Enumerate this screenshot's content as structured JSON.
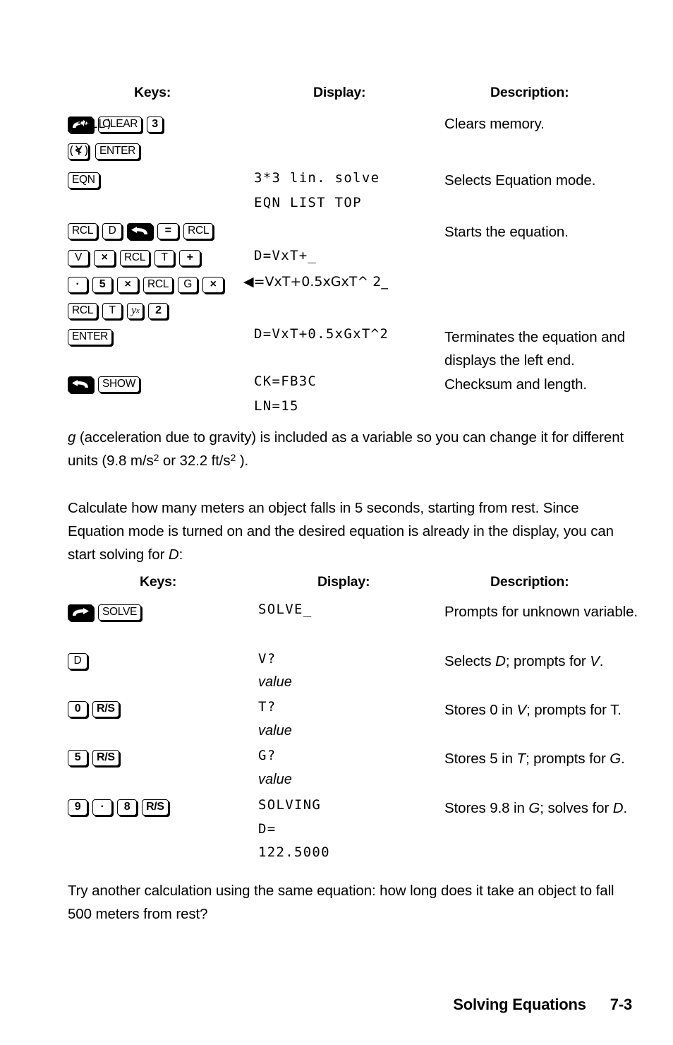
{
  "table1": {
    "headers": {
      "keys": "Keys:",
      "display": "Display:",
      "description": "Description:"
    },
    "rows": [
      {
        "keys_lines": [
          [
            {
              "type": "key",
              "style": "shift",
              "icon": "right-shift-arrow-icon"
            },
            {
              "type": "key",
              "label": "CLEAR"
            },
            {
              "type": "key",
              "label": "3",
              "bold": true
            },
            {
              "type": "text",
              "label": "(3ALL)",
              "lcd": true
            }
          ],
          [
            {
              "type": "key",
              "label": "<",
              "bold": true
            },
            {
              "type": "text",
              "label": "(Y)",
              "lcd": true
            },
            {
              "type": "key",
              "label": "ENTER"
            }
          ]
        ],
        "display_lines": [],
        "description": "Clears memory."
      },
      {
        "keys_lines": [
          [
            {
              "type": "key",
              "label": "EQN"
            }
          ]
        ],
        "display_lines": [
          "3*3 lin. solve",
          "EQN LIST TOP"
        ],
        "description": "Selects Equation mode."
      },
      {
        "keys_lines": [
          [
            {
              "type": "key",
              "label": "RCL"
            },
            {
              "type": "key",
              "label": "D"
            },
            {
              "type": "key",
              "style": "backarrow",
              "icon": "backspace-arrow-icon"
            },
            {
              "type": "key",
              "label": "="
            },
            {
              "type": "key",
              "label": "RCL"
            }
          ],
          [
            {
              "type": "key",
              "label": "V"
            },
            {
              "type": "key",
              "label": "×",
              "bold": true
            },
            {
              "type": "key",
              "label": "RCL"
            },
            {
              "type": "key",
              "label": "T"
            },
            {
              "type": "key",
              "label": "+",
              "bold": true
            }
          ],
          [
            {
              "type": "key",
              "label": "·",
              "bold": true
            },
            {
              "type": "key",
              "label": "5",
              "bold": true
            },
            {
              "type": "key",
              "label": "×",
              "bold": true
            },
            {
              "type": "key",
              "label": "RCL"
            },
            {
              "type": "key",
              "label": "G"
            },
            {
              "type": "key",
              "label": "×",
              "bold": true
            }
          ],
          [
            {
              "type": "key",
              "label": "RCL"
            },
            {
              "type": "key",
              "label": "T"
            },
            {
              "type": "key",
              "label": "yx",
              "serif": true
            },
            {
              "type": "key",
              "label": "2",
              "bold": true
            }
          ]
        ],
        "display_lines": [
          "D=VxT+_",
          "◀=VxT+0.5xGxT^ 2_"
        ],
        "description": "Starts the equation."
      },
      {
        "keys_lines": [
          [
            {
              "type": "key",
              "label": "ENTER"
            }
          ]
        ],
        "display_lines": [
          "D=VxT+0.5xGxT^2"
        ],
        "description": "Terminates the equation and displays the left end."
      },
      {
        "keys_lines": [
          [
            {
              "type": "key",
              "style": "backarrow",
              "icon": "backspace-arrow-icon"
            },
            {
              "type": "key",
              "label": "SHOW"
            }
          ]
        ],
        "display_lines": [
          "CK=FB3C",
          "LN=15"
        ],
        "description": "Checksum and length."
      }
    ]
  },
  "paragraphs": {
    "gravity_note_1": "g",
    "gravity_note_2": " (acceleration due to gravity) is included as a variable so you can change it for different units (9.8 m/s",
    "gravity_sup_1": "2",
    "gravity_note_3": " or 32.2 ft/s",
    "gravity_sup_2": "2",
    "gravity_note_4": " ).",
    "calc_intro_1": "Calculate how many meters an object falls in 5 seconds, starting from rest. Since Equation mode is turned on and the desired equation is already in the display, you can start solving for ",
    "calc_intro_var": "D",
    "calc_intro_2": ":",
    "closing_1": "Try another calculation using the same equation: how long does it take an object to fall 500 meters from rest?"
  },
  "table2": {
    "headers": {
      "keys": "Keys:",
      "display": "Display:",
      "description": "Description:"
    },
    "rows": [
      {
        "keys_lines": [
          [
            {
              "type": "key",
              "style": "shift",
              "icon": "right-shift-arrow-icon"
            },
            {
              "type": "key",
              "label": "SOLVE"
            }
          ]
        ],
        "display_lines": [
          {
            "text": "SOLVE_",
            "italic": false
          }
        ],
        "description": "Prompts for unknown variable."
      },
      {
        "keys_lines": [
          [
            {
              "type": "key",
              "label": "D"
            }
          ]
        ],
        "display_lines": [
          {
            "text": "V?",
            "italic": false
          },
          {
            "text": "value",
            "italic": true
          }
        ],
        "description_parts": [
          {
            "t": "Selects ",
            "i": false
          },
          {
            "t": "D",
            "i": true
          },
          {
            "t": "; prompts for ",
            "i": false
          },
          {
            "t": "V",
            "i": true
          },
          {
            "t": ".",
            "i": false
          }
        ]
      },
      {
        "keys_lines": [
          [
            {
              "type": "key",
              "label": "0",
              "bold": true
            },
            {
              "type": "key",
              "label": "R/S",
              "bold": true
            }
          ]
        ],
        "display_lines": [
          {
            "text": "T?",
            "italic": false
          },
          {
            "text": "value",
            "italic": true
          }
        ],
        "description_parts": [
          {
            "t": "Stores 0 in ",
            "i": false
          },
          {
            "t": "V",
            "i": true
          },
          {
            "t": "; prompts for T.",
            "i": false
          }
        ]
      },
      {
        "keys_lines": [
          [
            {
              "type": "key",
              "label": "5",
              "bold": true
            },
            {
              "type": "key",
              "label": "R/S",
              "bold": true
            }
          ]
        ],
        "display_lines": [
          {
            "text": "G?",
            "italic": false
          },
          {
            "text": "value",
            "italic": true
          }
        ],
        "description_parts": [
          {
            "t": "Stores 5 in ",
            "i": false
          },
          {
            "t": "T",
            "i": true
          },
          {
            "t": "; prompts for ",
            "i": false
          },
          {
            "t": "G",
            "i": true
          },
          {
            "t": ".",
            "i": false
          }
        ]
      },
      {
        "keys_lines": [
          [
            {
              "type": "key",
              "label": "9",
              "bold": true
            },
            {
              "type": "key",
              "label": "·",
              "bold": true
            },
            {
              "type": "key",
              "label": "8",
              "bold": true
            },
            {
              "type": "key",
              "label": "R/S",
              "bold": true
            }
          ]
        ],
        "display_lines": [
          {
            "text": "SOLVING",
            "italic": false
          },
          {
            "text": "D=",
            "italic": false
          },
          {
            "text": "122.5000",
            "italic": false
          }
        ],
        "description_parts": [
          {
            "t": "Stores 9.8 in ",
            "i": false
          },
          {
            "t": "G",
            "i": true
          },
          {
            "t": "; solves for ",
            "i": false
          },
          {
            "t": "D",
            "i": true
          },
          {
            "t": ".",
            "i": false
          }
        ]
      }
    ]
  },
  "footer": {
    "title": "Solving Equations",
    "page": "7-3"
  },
  "colors": {
    "ink": "#000000",
    "paper": "#ffffff"
  }
}
